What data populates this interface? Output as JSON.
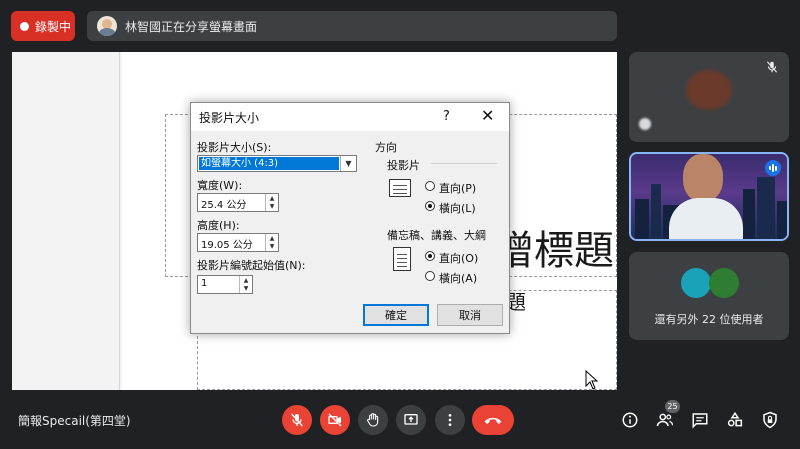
{
  "recording": {
    "label": "錄製中"
  },
  "presenter": {
    "text": "林智國正在分享螢幕畫面"
  },
  "slide": {
    "title": "增標題",
    "subtitle": "題"
  },
  "dialog": {
    "title": "投影片大小",
    "help": "?",
    "close": "✕",
    "size_label": "投影片大小(S):",
    "size_value": "如螢幕大小 (4:3)",
    "width_label": "寬度(W):",
    "width_value": "25.4 公分",
    "height_label": "高度(H):",
    "height_value": "19.05 公分",
    "start_label": "投影片編號起始值(N):",
    "start_value": "1",
    "orientation_label": "方向",
    "slides_label": "投影片",
    "slides_portrait": "直向(P)",
    "slides_landscape": "橫向(L)",
    "notes_label": "備忘稿、講義、大綱",
    "notes_portrait": "直向(O)",
    "notes_landscape": "橫向(A)",
    "ok": "確定",
    "cancel": "取消"
  },
  "tiles": {
    "others": "還有另外 22 位使用者"
  },
  "meeting": {
    "name": "簡報Specail(第四堂)",
    "participants": "25"
  },
  "colors": {
    "red": "#ea4335",
    "accent": "#1a73e8",
    "bg": "#202124"
  }
}
